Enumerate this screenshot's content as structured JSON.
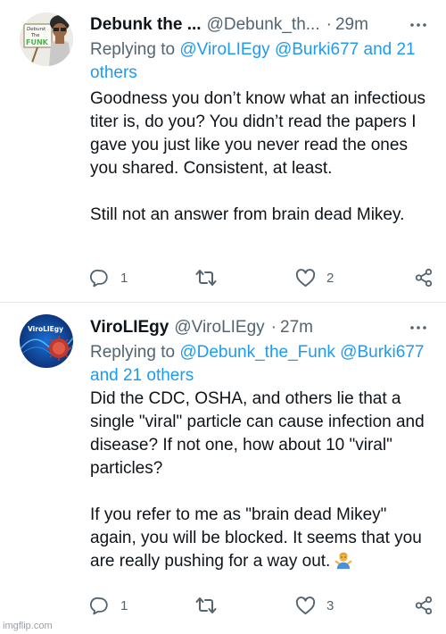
{
  "tweets": [
    {
      "author_name": "Debunk the ...",
      "author_handle": "@Debunk_th...",
      "time_sep": "·",
      "time": "29m",
      "reply_label": "Replying to",
      "reply_mentions": "@ViroLIEgy @Burki677 and 21 others",
      "paragraphs": [
        "Goodness you don’t know what an infectious titer is, do you? You didn’t read the papers I gave you just like you never read the ones you shared. Consistent, at least.",
        "Still not an answer from brain dead Mikey."
      ],
      "avatar_text": [
        "Debunk",
        "The",
        "FUNK"
      ],
      "counts": {
        "replies": "1",
        "retweets": "",
        "likes": "2"
      }
    },
    {
      "author_name": "ViroLIEgy",
      "author_handle": "@ViroLIEgy",
      "time_sep": "·",
      "time": "27m",
      "reply_label": "Replying to",
      "reply_mentions": "@Debunk_the_Funk @Burki677 and 21 others",
      "paragraphs": [
        "Did the CDC, OSHA, and others lie that a single \"viral\" particle can cause infection and disease? If not one, how about 10 \"viral\" particles?",
        "If you refer to me as \"brain dead Mikey\" again, you will be blocked. It seems that you are really pushing for a way out."
      ],
      "avatar_text": [
        "ViroLIEgy"
      ],
      "counts": {
        "replies": "1",
        "retweets": "",
        "likes": "3"
      }
    }
  ],
  "icons": {
    "more": "more-dots-icon",
    "reply": "reply-bubble-icon",
    "retweet": "retweet-icon",
    "like": "heart-icon",
    "share": "share-icon",
    "emoji": "person-shrugging-emoji"
  },
  "watermark": "imgflip.com",
  "colors": {
    "link": "#1d9bf0",
    "secondary_text": "#536471",
    "primary_text": "#0f1419"
  }
}
